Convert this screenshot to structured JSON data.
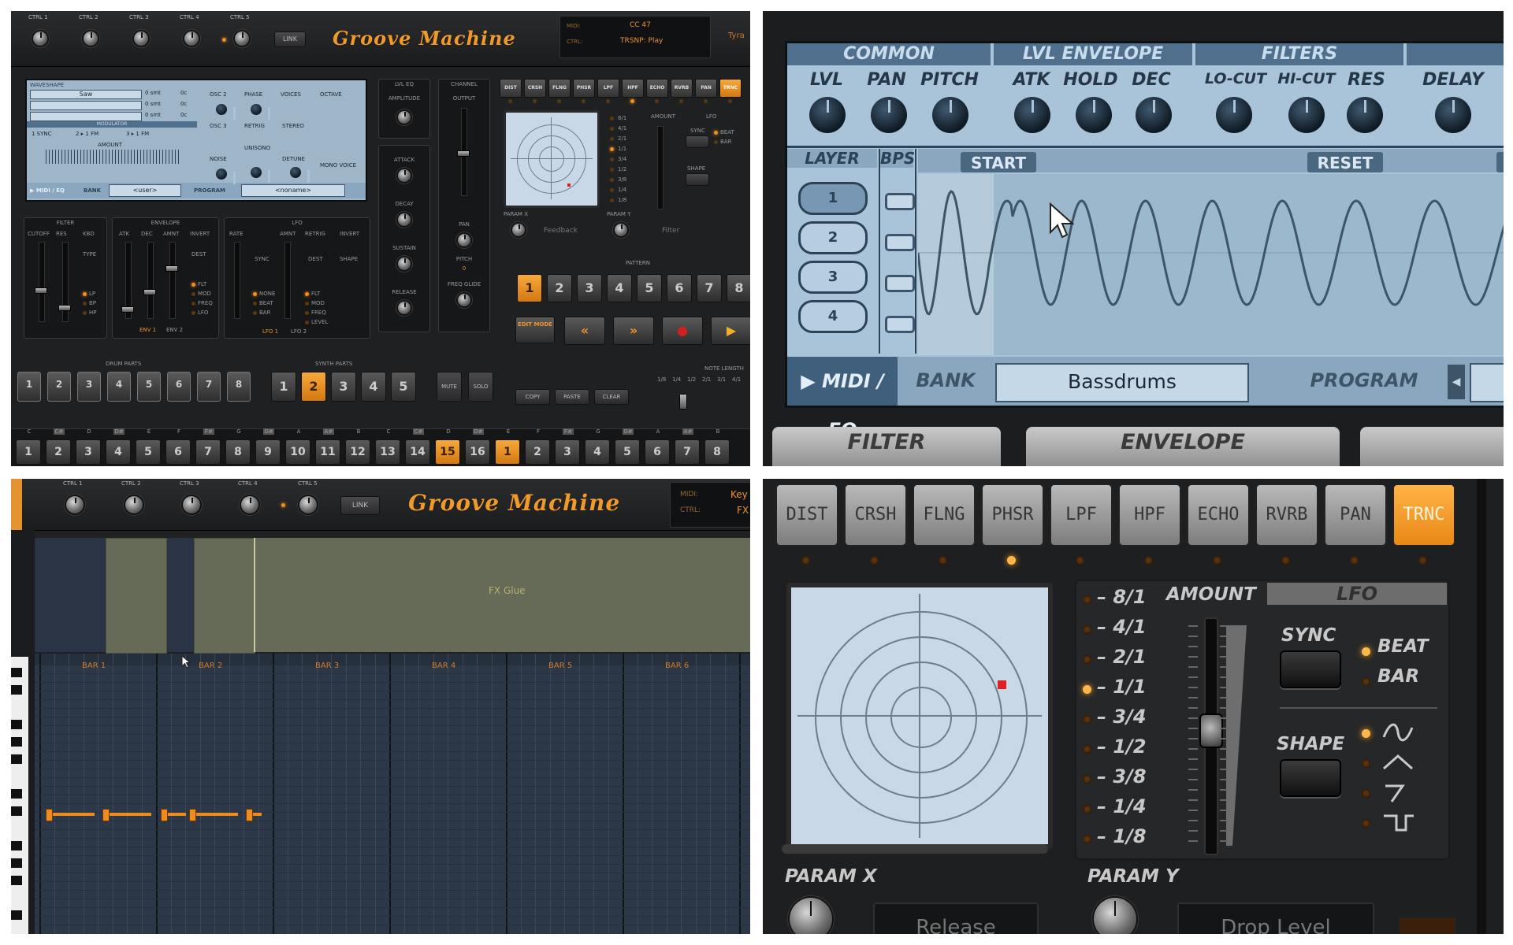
{
  "q1": {
    "ctrl_labels": [
      "CTRL 1",
      "CTRL 2",
      "CTRL 3",
      "CTRL 4",
      "CTRL 5"
    ],
    "link_label": "LINK",
    "logo": "Groove Machine",
    "midi_label": "MIDI:",
    "ctrl_label": "CTRL:",
    "midi_value": "CC 47",
    "ctrl_value": "TRSNP: Play",
    "right_edge_text": "Tyra",
    "screen": {
      "waveshape_hdr": "WAVESHAPE",
      "wave_value": "Saw",
      "pitch_vals": [
        "0 smt",
        "0 smt",
        "0 smt"
      ],
      "fine_vals": [
        "0c",
        "0c",
        "0c"
      ],
      "modulator": "MODULATOR",
      "amount": "AMOUNT",
      "sync_opts": [
        "1 SYNC",
        "2 ▸ 1 FM",
        "3 ▸ 1 FM"
      ],
      "midi_eq": "▶ MIDI / EQ",
      "bank": "BANK",
      "bank_value": "<user>",
      "program": "PROGRAM",
      "program_value": "<noname>",
      "right_labels": [
        "OSC 2",
        "PHASE",
        "VOICES",
        "OCTAVE",
        "OSC 3",
        "RETRIG",
        "STEREO",
        "UNISONO",
        "NOISE",
        "DETUNE",
        "MONO VOICE"
      ]
    },
    "lvl_eq": "LVL EQ",
    "amplitude": "AMPLITUDE",
    "adsr": [
      "ATTACK",
      "DECAY",
      "SUSTAIN",
      "RELEASE"
    ],
    "channel": "CHANNEL",
    "output": "OUTPUT",
    "pan": "PAN",
    "pitch": "PITCH",
    "pitch_val": "0",
    "freq_glide": "FREQ GLIDE",
    "fx_buttons": [
      "DIST",
      "CRSH",
      "FLNG",
      "PHSR",
      "LPF",
      "HPF",
      "ECHO",
      "RVRB",
      "PAN",
      "TRNC"
    ],
    "rates": [
      "8/1",
      "4/1",
      "2/1",
      "1/1",
      "3/4",
      "1/2",
      "3/8",
      "1/4",
      "1/8"
    ],
    "lfo": "LFO",
    "amount_lbl": "AMOUNT",
    "sync": "SYNC",
    "beat": "BEAT",
    "bar": "BAR",
    "shape": "SHAPE",
    "param_x": "PARAM X",
    "param_y": "PARAM Y",
    "param_x_value": "Feedback",
    "param_y_value": "Filter",
    "filter": "FILTER",
    "filter_lbls": [
      "CUTOFF",
      "RES",
      "KBD",
      "TYPE"
    ],
    "filter_types": [
      "LP",
      "BP",
      "HP"
    ],
    "envelope": "ENVELOPE",
    "env_lbls": [
      "ATK",
      "DEC",
      "AMNT",
      "INVERT",
      "DEST"
    ],
    "env_dest": [
      "FLT",
      "MOD",
      "FREQ",
      "LFO"
    ],
    "env_footer": [
      "ENV 1",
      "ENV 2"
    ],
    "lfo2": "LFO",
    "lfo_lbls": [
      "RATE",
      "AMNT",
      "RETRIG",
      "INVERT",
      "SYNC",
      "DEST",
      "SHAPE"
    ],
    "lfo_sync": [
      "NONE",
      "BEAT",
      "BAR"
    ],
    "lfo_dest": [
      "FLT",
      "MOD",
      "FREQ",
      "LEVEL"
    ],
    "lfo_footer": [
      "LFO 1",
      "LFO 2"
    ],
    "pattern": "PATTERN",
    "pattern_nums": [
      "1",
      "2",
      "3",
      "4",
      "5",
      "6",
      "7",
      "8"
    ],
    "edit_mode": "EDIT MODE",
    "drum_parts": "DRUM PARTS",
    "drum_nums": [
      "1",
      "2",
      "3",
      "4",
      "5",
      "6",
      "7",
      "8"
    ],
    "synth_parts": "SYNTH PARTS",
    "synth_nums": [
      "1",
      "2",
      "3",
      "4",
      "5"
    ],
    "mute": "MUTE",
    "solo": "SOLO",
    "copy": "COPY",
    "paste": "PASTE",
    "clear": "CLEAR",
    "note_length": "NOTE LENGTH",
    "note_lengths": [
      "1/8",
      "1/4",
      "1/2",
      "2/1",
      "3/1",
      "4/1"
    ],
    "keys": [
      "C",
      "C#",
      "D",
      "D#",
      "E",
      "F",
      "F#",
      "G",
      "G#",
      "A",
      "A#",
      "B",
      "C",
      "C#",
      "D",
      "D#",
      "E",
      "F",
      "F#",
      "G",
      "G#",
      "A",
      "A#",
      "B"
    ],
    "steps": [
      "1",
      "2",
      "3",
      "4",
      "5",
      "6",
      "7",
      "8",
      "9",
      "10",
      "11",
      "12",
      "13",
      "14",
      "15",
      "16",
      "1",
      "2",
      "3",
      "4",
      "5",
      "6",
      "7",
      "8"
    ]
  },
  "q2": {
    "sections": [
      "COMMON",
      "LVL ENVELOPE",
      "FILTERS"
    ],
    "knob_labels": [
      "LVL",
      "PAN",
      "PITCH",
      "ATK",
      "HOLD",
      "DEC",
      "LO-CUT",
      "HI-CUT",
      "RES",
      "DELAY"
    ],
    "layer": "LAYER",
    "bps": "BPS",
    "layers": [
      "1",
      "2",
      "3",
      "4"
    ],
    "start": "START",
    "reset": "RESET",
    "midi_eq": "▶ MIDI / EQ",
    "bank": "BANK",
    "bank_value": "Bassdrums",
    "program": "PROGRAM",
    "tabs": [
      "FILTER",
      "ENVELOPE"
    ]
  },
  "q3": {
    "ctrl_labels": [
      "CTRL 1",
      "CTRL 2",
      "CTRL 3",
      "CTRL 4",
      "CTRL 5"
    ],
    "link_label": "LINK",
    "logo": "Groove Machine",
    "midi_label": "MIDI:",
    "ctrl_label": "CTRL:",
    "midi_value": "Key",
    "ctrl_value": "FX",
    "clip_name": "FX Glue",
    "bars": [
      "BAR 1",
      "BAR 2",
      "BAR 3",
      "BAR 4",
      "BAR 5",
      "BAR 6"
    ]
  },
  "q4": {
    "fx_buttons": [
      "DIST",
      "CRSH",
      "FLNG",
      "PHSR",
      "LPF",
      "HPF",
      "ECHO",
      "RVRB",
      "PAN",
      "TRNC"
    ],
    "active_fx": "TRNC",
    "rates": [
      "– 8/1",
      "– 4/1",
      "– 2/1",
      "– 1/1",
      "– 3/4",
      "– 1/2",
      "– 3/8",
      "– 1/4",
      "– 1/8"
    ],
    "active_rate": "– 1/1",
    "amount": "AMOUNT",
    "lfo": "LFO",
    "sync": "SYNC",
    "beat": "BEAT",
    "bar": "BAR",
    "shape": "SHAPE",
    "param_x": "PARAM X",
    "param_y": "PARAM Y",
    "param_x_value": "Release",
    "param_y_value": "Drop Level"
  },
  "colors": {
    "accent": "#f0901e",
    "screen": "#a9c3d8",
    "panel": "#1e1f21"
  }
}
